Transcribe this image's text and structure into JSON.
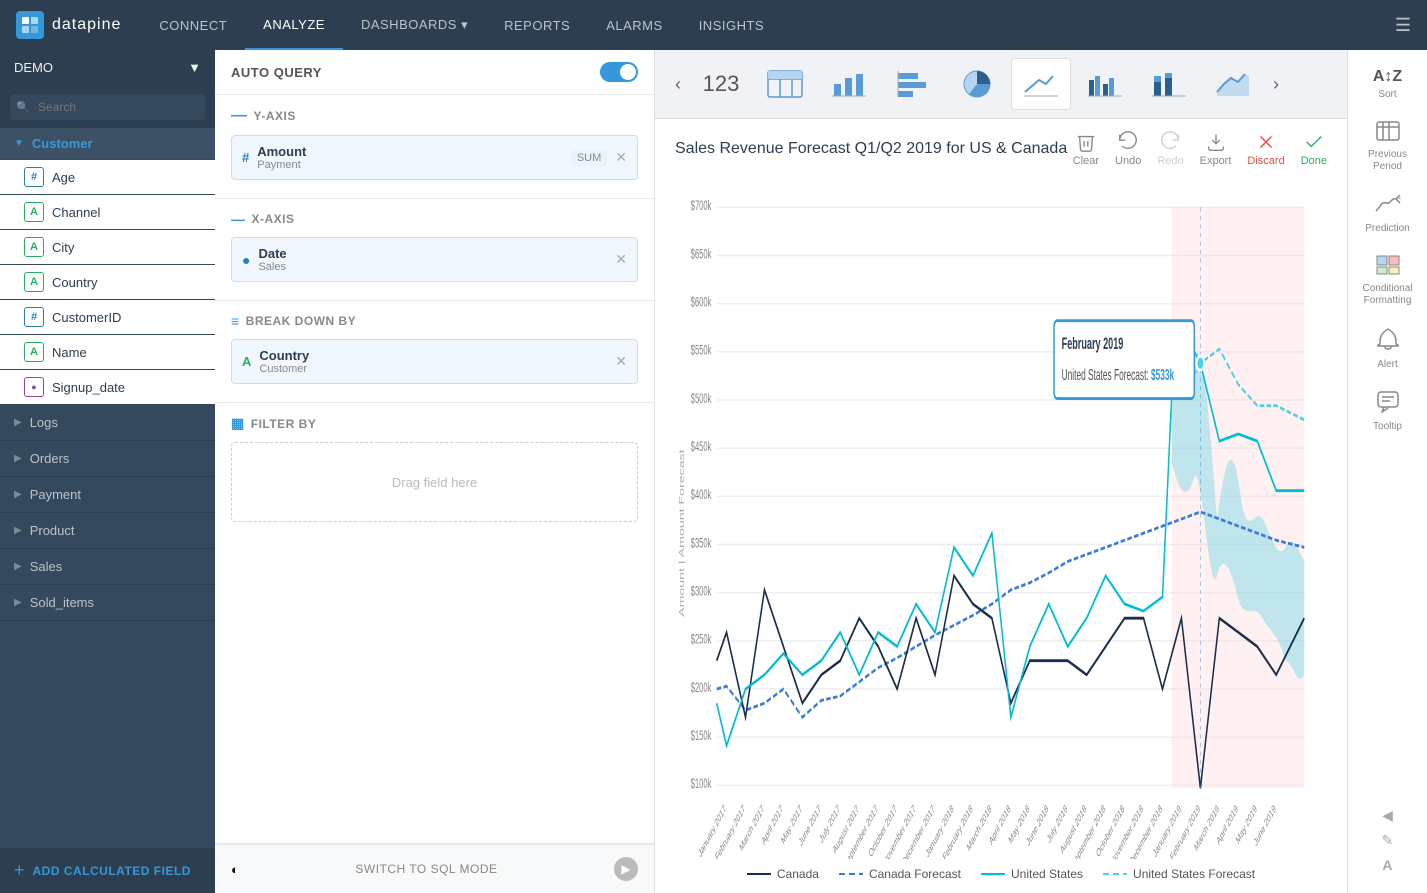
{
  "topnav": {
    "logo_letter": "d",
    "logo_text": "datapine",
    "items": [
      {
        "label": "CONNECT",
        "active": false
      },
      {
        "label": "ANALYZE",
        "active": true
      },
      {
        "label": "DASHBOARDS ▾",
        "active": false
      },
      {
        "label": "REPORTS",
        "active": false
      },
      {
        "label": "ALARMS",
        "active": false
      },
      {
        "label": "INSIGHTS",
        "active": false
      }
    ]
  },
  "sidebar": {
    "demo_label": "DEMO",
    "search_placeholder": "Search",
    "customer_group": {
      "label": "Customer",
      "fields": [
        {
          "name": "Age",
          "type": "hash"
        },
        {
          "name": "Channel",
          "type": "alpha"
        },
        {
          "name": "City",
          "type": "alpha"
        },
        {
          "name": "Country",
          "type": "alpha"
        },
        {
          "name": "CustomerID",
          "type": "hash"
        },
        {
          "name": "Name",
          "type": "alpha"
        },
        {
          "name": "Signup_date",
          "type": "clock"
        }
      ]
    },
    "collapsed_groups": [
      "Logs",
      "Orders",
      "Payment",
      "Product",
      "Sales",
      "Sold_items"
    ],
    "add_field_label": "ADD CALCULATED FIELD"
  },
  "query_panel": {
    "auto_query_label": "AUTO QUERY",
    "y_axis_label": "Y-AXIS",
    "x_axis_label": "X-AXIS",
    "breakdown_label": "BREAK DOWN BY",
    "filter_label": "FILTER BY",
    "filter_placeholder": "Drag field here",
    "y_field": {
      "name": "Amount",
      "sub": "Payment",
      "agg": "SUM"
    },
    "x_field": {
      "name": "Date",
      "sub": "Sales"
    },
    "breakdown_field": {
      "name": "Country",
      "sub": "Customer"
    },
    "sql_mode_label": "SWITCH TO SQL MODE"
  },
  "chart": {
    "title": "Sales Revenue Forecast Q1/Q2 2019 for US & Canada",
    "actions": [
      "Clear",
      "Undo",
      "Redo",
      "Export",
      "Discard",
      "Done"
    ],
    "y_axis_label": "Amount | Amount Forecast",
    "tooltip": {
      "title": "February 2019",
      "line1": "United States Forecast:",
      "value": "$533k"
    },
    "legend": [
      {
        "label": "Canada",
        "color": "#1a2e4a",
        "dash": false
      },
      {
        "label": "Canada Forecast",
        "color": "#3a7bd5",
        "dash": true
      },
      {
        "label": "United States",
        "color": "#00bcd4",
        "dash": false
      },
      {
        "label": "United States Forecast",
        "color": "#4dd0e1",
        "dash": true
      }
    ],
    "y_ticks": [
      "$700k",
      "$650k",
      "$600k",
      "$550k",
      "$500k",
      "$450k",
      "$400k",
      "$350k",
      "$300k",
      "$250k",
      "$200k",
      "$150k",
      "$100k"
    ],
    "x_ticks": [
      "January 2017",
      "February 2017",
      "March 2017",
      "April 2017",
      "May 2017",
      "June 2017",
      "July 2017",
      "August 2017",
      "September 2017",
      "October 2017",
      "November 2017",
      "December 2017",
      "January 2018",
      "February 2018",
      "March 2018",
      "April 2018",
      "May 2018",
      "June 2018",
      "July 2018",
      "August 2018",
      "September 2018",
      "October 2018",
      "November 2018",
      "December 2018",
      "January 2019",
      "February 2019",
      "March 2019",
      "April 2019",
      "May 2019",
      "June 2019"
    ]
  },
  "chart_types": [
    {
      "name": "table",
      "icon": "table"
    },
    {
      "name": "bar",
      "icon": "bar"
    },
    {
      "name": "hbar",
      "icon": "hbar"
    },
    {
      "name": "pie",
      "icon": "pie"
    },
    {
      "name": "line",
      "icon": "line",
      "active": true
    },
    {
      "name": "grouped-bar",
      "icon": "gbar"
    },
    {
      "name": "stacked-bar",
      "icon": "sbar"
    },
    {
      "name": "area",
      "icon": "area"
    }
  ],
  "right_panel": {
    "items": [
      {
        "label": "Sort",
        "icon": "AZ"
      },
      {
        "label": "Previous Period",
        "icon": "⊞"
      },
      {
        "label": "Prediction",
        "icon": "∿"
      },
      {
        "label": "Conditional Formatting",
        "icon": "▦"
      },
      {
        "label": "Alert",
        "icon": "🔔"
      },
      {
        "label": "Tooltip",
        "icon": "💬"
      }
    ]
  }
}
